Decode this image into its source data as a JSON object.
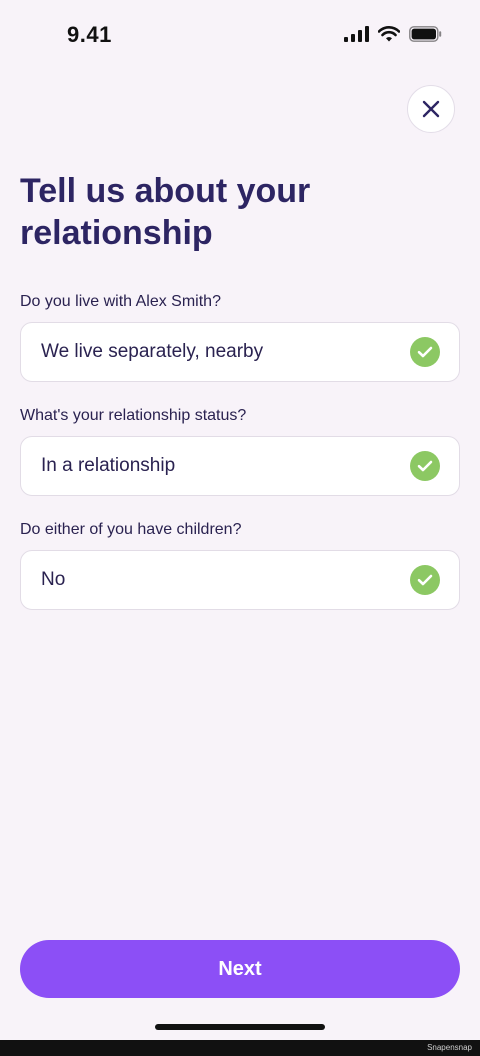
{
  "status_bar": {
    "time": "9.41",
    "icons": [
      "signal-icon",
      "wifi-icon",
      "battery-icon"
    ]
  },
  "header": {
    "close_icon": "close-icon",
    "title": "Tell us about your relationship"
  },
  "questions": [
    {
      "label": "Do you live with Alex Smith?",
      "value": "We live separately, nearby",
      "status_icon": "check-icon"
    },
    {
      "label": "What's your relationship status?",
      "value": "In a relationship",
      "status_icon": "check-icon"
    },
    {
      "label": "Do either of you have children?",
      "value": "No",
      "status_icon": "check-icon"
    }
  ],
  "footer": {
    "next_label": "Next"
  },
  "watermark": "Snapensnap",
  "colors": {
    "background": "#f8f3f9",
    "title": "#2d2563",
    "primary_button": "#8c4ff6",
    "check": "#8cc863"
  }
}
